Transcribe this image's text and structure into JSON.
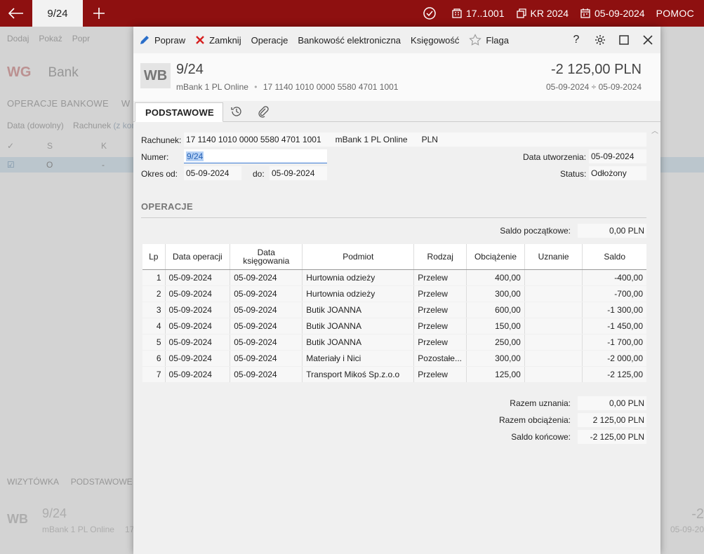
{
  "topbar": {
    "tab_label": "9/24",
    "period_label": "17..1001",
    "register_label": "KR 2024",
    "date_label": "05-09-2024",
    "help_label": "POMOC"
  },
  "background": {
    "toolbar": [
      "Dodaj",
      "Pokaż",
      "Popr"
    ],
    "module_code": "WG",
    "module_name": "Bank",
    "tab_label": "OPERACJE BANKOWE",
    "tab_label2": "W",
    "filter_label": "Data (dowolny)",
    "filter_label2": "Rachunek",
    "filter_link": "(z kon",
    "col_s": "S",
    "col_k": "K",
    "row_s": "O",
    "row_k": "-",
    "bottom_tab1": "WIZYTÓWKA",
    "bottom_tab2": "PODSTAWOWE",
    "card_code": "WB",
    "card_number": "9/24",
    "card_sub": "mBank 1 PL Online",
    "card_sub2": "17",
    "right_amount": "-2",
    "right_date": "05-09-20"
  },
  "toolbar": {
    "edit_label": "Popraw",
    "close_label": "Zamknij",
    "operations_label": "Operacje",
    "ebanking_label": "Bankowość elektroniczna",
    "accounting_label": "Księgowość",
    "flag_label": "Flaga",
    "help_label": "?"
  },
  "header": {
    "code": "WB",
    "number": "9/24",
    "bank": "mBank 1 PL Online",
    "separator": "•",
    "account": "17 1140 1010 0000 5580 4701 1001",
    "amount": "-2 125,00 PLN",
    "date_range": "05-09-2024 ÷ 05-09-2024"
  },
  "tabs": {
    "main_label": "PODSTAWOWE"
  },
  "form": {
    "account_label": "Rachunek:",
    "account_number": "17 1140 1010 0000 5580 4701 1001",
    "account_bank": "mBank 1 PL Online",
    "account_currency": "PLN",
    "number_label": "Numer:",
    "number_value": "9/24",
    "period_from_label": "Okres od:",
    "period_from_value": "05-09-2024",
    "period_to_label": "do:",
    "period_to_value": "05-09-2024",
    "created_label": "Data utworzenia:",
    "created_value": "05-09-2024",
    "status_label": "Status:",
    "status_value": "Odłożony"
  },
  "operations": {
    "section_title": "OPERACJE",
    "opening_label": "Saldo początkowe:",
    "opening_value": "0,00 PLN",
    "columns": [
      "Lp",
      "Data operacji",
      "Data księgowania",
      "Podmiot",
      "Rodzaj",
      "Obciążenie",
      "Uznanie",
      "Saldo"
    ],
    "rows": [
      {
        "lp": "1",
        "op_date": "05-09-2024",
        "book_date": "05-09-2024",
        "party": "Hurtownia odzieży",
        "kind": "Przelew",
        "debit": "400,00",
        "credit": "",
        "balance": "-400,00"
      },
      {
        "lp": "2",
        "op_date": "05-09-2024",
        "book_date": "05-09-2024",
        "party": "Hurtownia odzieży",
        "kind": "Przelew",
        "debit": "300,00",
        "credit": "",
        "balance": "-700,00"
      },
      {
        "lp": "3",
        "op_date": "05-09-2024",
        "book_date": "05-09-2024",
        "party": "Butik JOANNA",
        "kind": "Przelew",
        "debit": "600,00",
        "credit": "",
        "balance": "-1 300,00"
      },
      {
        "lp": "4",
        "op_date": "05-09-2024",
        "book_date": "05-09-2024",
        "party": "Butik JOANNA",
        "kind": "Przelew",
        "debit": "150,00",
        "credit": "",
        "balance": "-1 450,00"
      },
      {
        "lp": "5",
        "op_date": "05-09-2024",
        "book_date": "05-09-2024",
        "party": "Butik JOANNA",
        "kind": "Przelew",
        "debit": "250,00",
        "credit": "",
        "balance": "-1 700,00"
      },
      {
        "lp": "6",
        "op_date": "05-09-2024",
        "book_date": "05-09-2024",
        "party": "Materiały i Nici",
        "kind": "Pozostałe...",
        "debit": "300,00",
        "credit": "",
        "balance": "-2 000,00"
      },
      {
        "lp": "7",
        "op_date": "05-09-2024",
        "book_date": "05-09-2024",
        "party": "Transport Mikoś Sp.z.o.o",
        "kind": "Przelew",
        "debit": "125,00",
        "credit": "",
        "balance": "-2 125,00"
      }
    ],
    "total_credit_label": "Razem uznania:",
    "total_credit_value": "0,00 PLN",
    "total_debit_label": "Razem obciążenia:",
    "total_debit_value": "2 125,00 PLN",
    "closing_label": "Saldo końcowe:",
    "closing_value": "-2 125,00 PLN"
  },
  "colors": {
    "topbar": "#8e1010",
    "selection": "#b7d2f5",
    "accent": "#3a7bd5"
  }
}
